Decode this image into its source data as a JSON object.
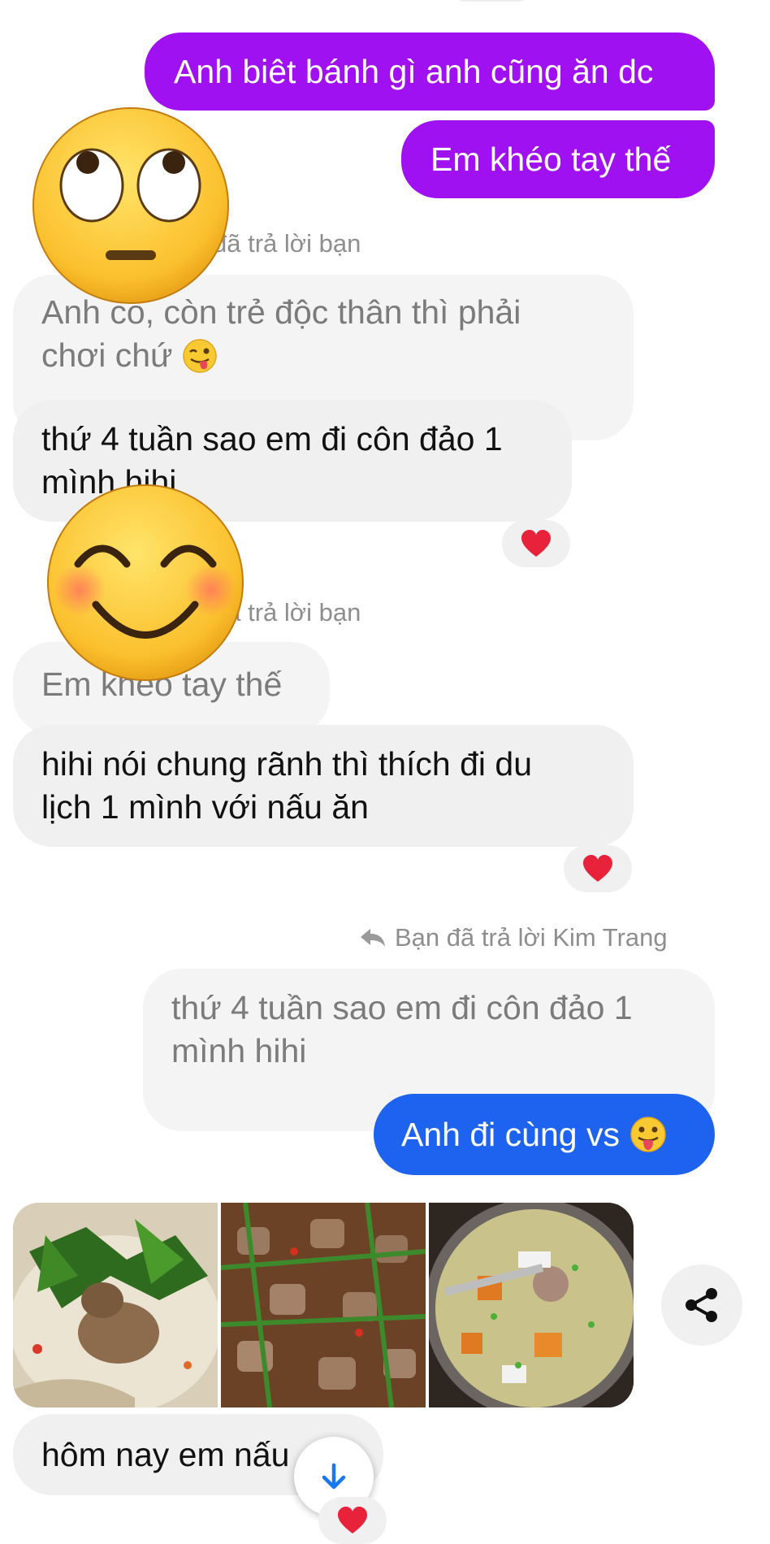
{
  "messages": {
    "sent_1": "Anh biêt bánh gì anh cũng ăn dc",
    "sent_2": "Em khéo tay thế",
    "reply_note_1": "đã trả lời bạn",
    "quoted_1_line1": "Anh co, còn trẻ độc thân thì phải",
    "quoted_1_line2": "chơi chứ",
    "recv_1_line1": "thứ 4 tuần sao em đi côn đảo 1",
    "recv_1_line2": "mình hihi",
    "reply_note_2": "đã trả lời bạn",
    "quoted_2": "Em khéo tay thế",
    "recv_2_line1": "hihi nói chung rãnh thì thích đi du",
    "recv_2_line2": "lịch 1 mình với  nấu ăn",
    "reply_note_3": "Bạn đã trả lời Kim Trang",
    "quoted_3_line1": "thứ 4 tuần sao em đi côn đảo 1",
    "quoted_3_line2": "mình hihi",
    "sent_3": "Anh đi cùng vs",
    "recv_3": "hôm nay em nấu"
  },
  "colors": {
    "sent_purple": "#a011f2",
    "sent_blue": "#1d63f0",
    "incoming_bg": "#f0f0f0",
    "heart": "#e8223a"
  },
  "icons": [
    "heart-icon",
    "reply-arrow-icon",
    "share-icon",
    "arrow-down-icon",
    "emoji-rolling-eyes",
    "emoji-smiling-blush",
    "emoji-winking-tongue",
    "emoji-tongue-out"
  ]
}
